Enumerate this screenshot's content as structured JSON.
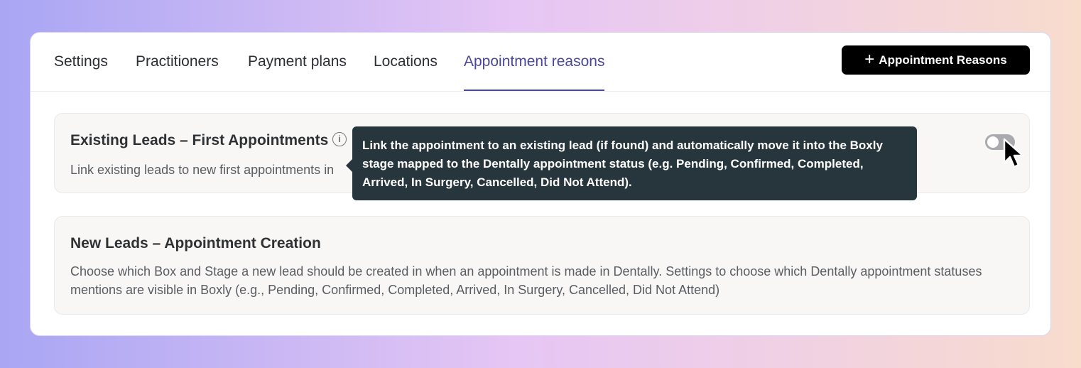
{
  "tabs": [
    {
      "label": "Settings"
    },
    {
      "label": "Practitioners"
    },
    {
      "label": "Payment plans"
    },
    {
      "label": "Locations"
    },
    {
      "label": "Appointment reasons",
      "active": true
    }
  ],
  "add_button": {
    "icon": "plus-icon",
    "label": "Appointment Reasons"
  },
  "cards": [
    {
      "title": "Existing Leads – First Appointments",
      "description": "Link existing leads to new first appointments in",
      "info_icon": "info-icon",
      "toggle": {
        "on": false
      }
    },
    {
      "title": "New Leads – Appointment Creation",
      "description": "Choose which Box and Stage a new lead should be created in when an appointment is made in Dentally. Settings to choose which Dentally appointment statuses mentions are visible in Boxly (e.g., Pending, Confirmed, Completed, Arrived, In Surgery, Cancelled, Did Not Attend)"
    }
  ],
  "tooltip": {
    "text": "Link the appointment to an existing lead (if found) and automatically move it into the Boxly stage mapped to the Dentally appointment status (e.g. Pending, Confirmed, Completed, Arrived, In Surgery, Cancelled, Did Not Attend)."
  },
  "colors": {
    "accent": "#4a4799",
    "tooltip_bg": "#26363c",
    "button_bg": "#000000",
    "toggle_off": "#a9aaad"
  }
}
